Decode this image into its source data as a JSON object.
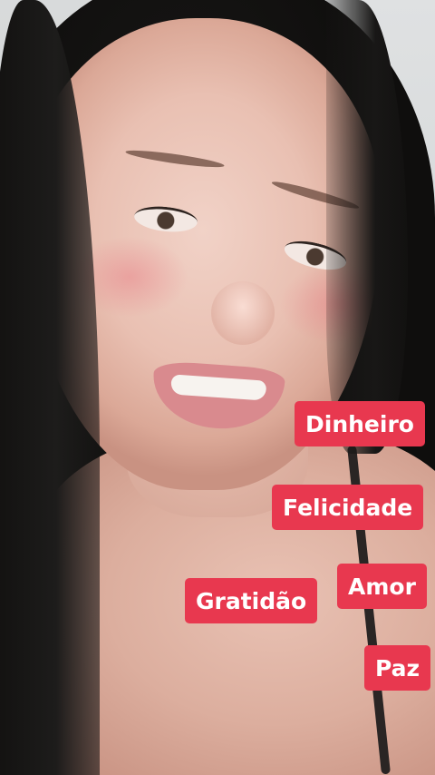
{
  "tags": {
    "dinheiro": "Dinheiro",
    "felicidade": "Felicidade",
    "amor": "Amor",
    "gratidao": "Gratidão",
    "paz": "Paz"
  },
  "colors": {
    "tag_background": "#e8384f",
    "tag_text": "#ffffff"
  }
}
